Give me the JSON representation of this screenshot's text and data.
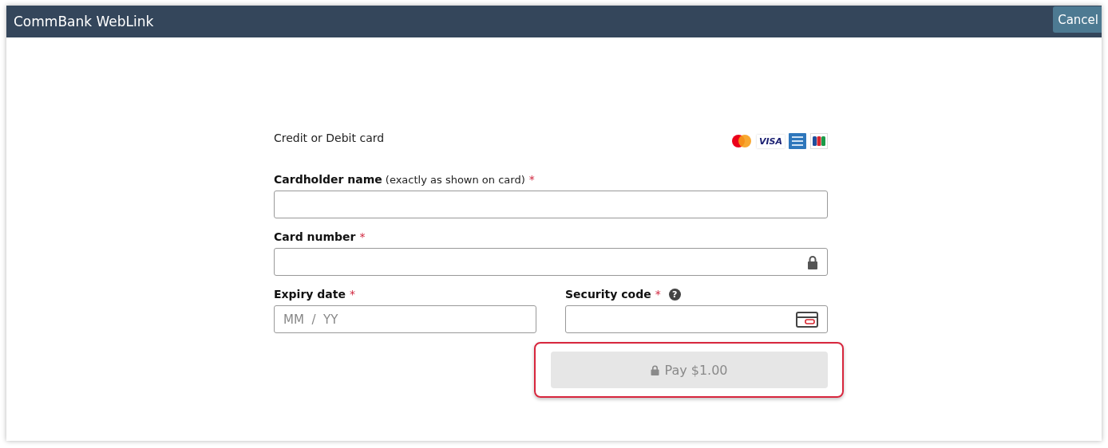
{
  "header": {
    "title": "CommBank WebLink",
    "cancel_button": "Cancel"
  },
  "form": {
    "heading": "Credit or Debit card",
    "cards": [
      {
        "kind": "mastercard"
      },
      {
        "kind": "visa",
        "label": "VISA"
      },
      {
        "kind": "amex"
      },
      {
        "kind": "jcb"
      }
    ],
    "cardholder": {
      "label": "Cardholder name",
      "hint": "(exactly as shown on card)",
      "required": "*"
    },
    "card_number": {
      "label": "Card number",
      "required": "*"
    },
    "expiry": {
      "label": "Expiry date",
      "required": "*",
      "placeholder": "MM  /  YY"
    },
    "security": {
      "label": "Security code",
      "required": "*",
      "help": "?"
    },
    "pay_button": {
      "label": "Pay $1.00",
      "disabled": true,
      "highlighted": true
    }
  }
}
